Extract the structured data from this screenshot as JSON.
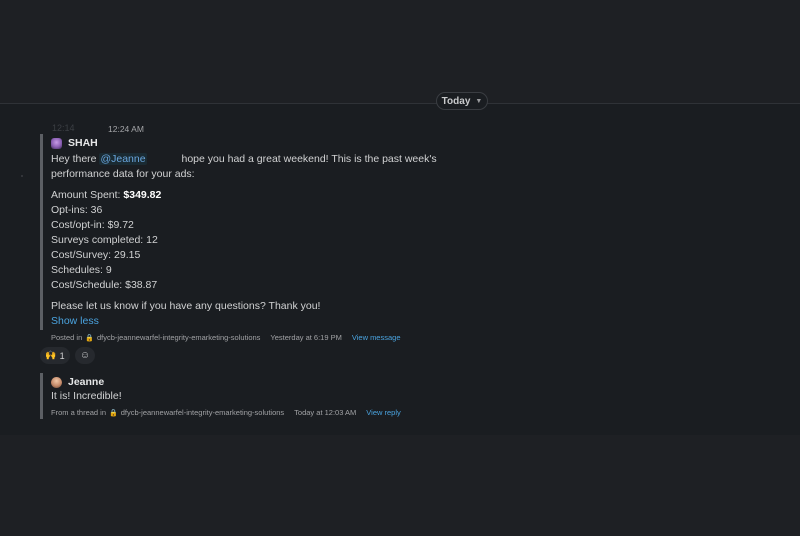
{
  "divider": {
    "label": "Today"
  },
  "message1": {
    "time_ghost": "12:14",
    "time": "12:24 AM",
    "author": "SHAH",
    "greeting_prefix": "Hey there ",
    "mention": "@Jeanne",
    "greeting_rest": " hope you had a great weekend! This is the past week's",
    "greeting_line2": "performance data for your ads:",
    "metrics": [
      {
        "label": "Amount Spent: ",
        "value": "$349.82"
      },
      {
        "label": "Opt-ins: 36",
        "value": ""
      },
      {
        "label": "Cost/opt-in: $9.72",
        "value": ""
      },
      {
        "label": "Surveys completed: 12",
        "value": ""
      },
      {
        "label": "Cost/Survey: 29.15",
        "value": ""
      },
      {
        "label": "Schedules: 9",
        "value": ""
      },
      {
        "label": "Cost/Schedule: $38.87",
        "value": ""
      }
    ],
    "closing": "Please let us know if you have any questions? Thank you!",
    "show_less": "Show less",
    "meta": {
      "posted_in": "Posted in",
      "channel": "dfycb-jeannewarfel-integrity-emarketing-solutions",
      "timestamp": "Yesterday at 6:19 PM",
      "view_link": "View message"
    }
  },
  "reactions": [
    {
      "emoji": "🙌",
      "count": "1"
    }
  ],
  "add_reaction_icon": "add-emoji-icon",
  "message2": {
    "author": "Jeanne",
    "text": "It is! Incredible!",
    "meta": {
      "from_thread": "From a thread in",
      "channel": "dfycb-jeannewarfel-integrity-emarketing-solutions",
      "timestamp": "Today at 12:03 AM",
      "view_link": "View reply"
    }
  },
  "colors": {
    "background": "#1a1d21",
    "link": "#4aa3df",
    "mention": "#69a6de",
    "quote_bar": "#5c5f64"
  }
}
